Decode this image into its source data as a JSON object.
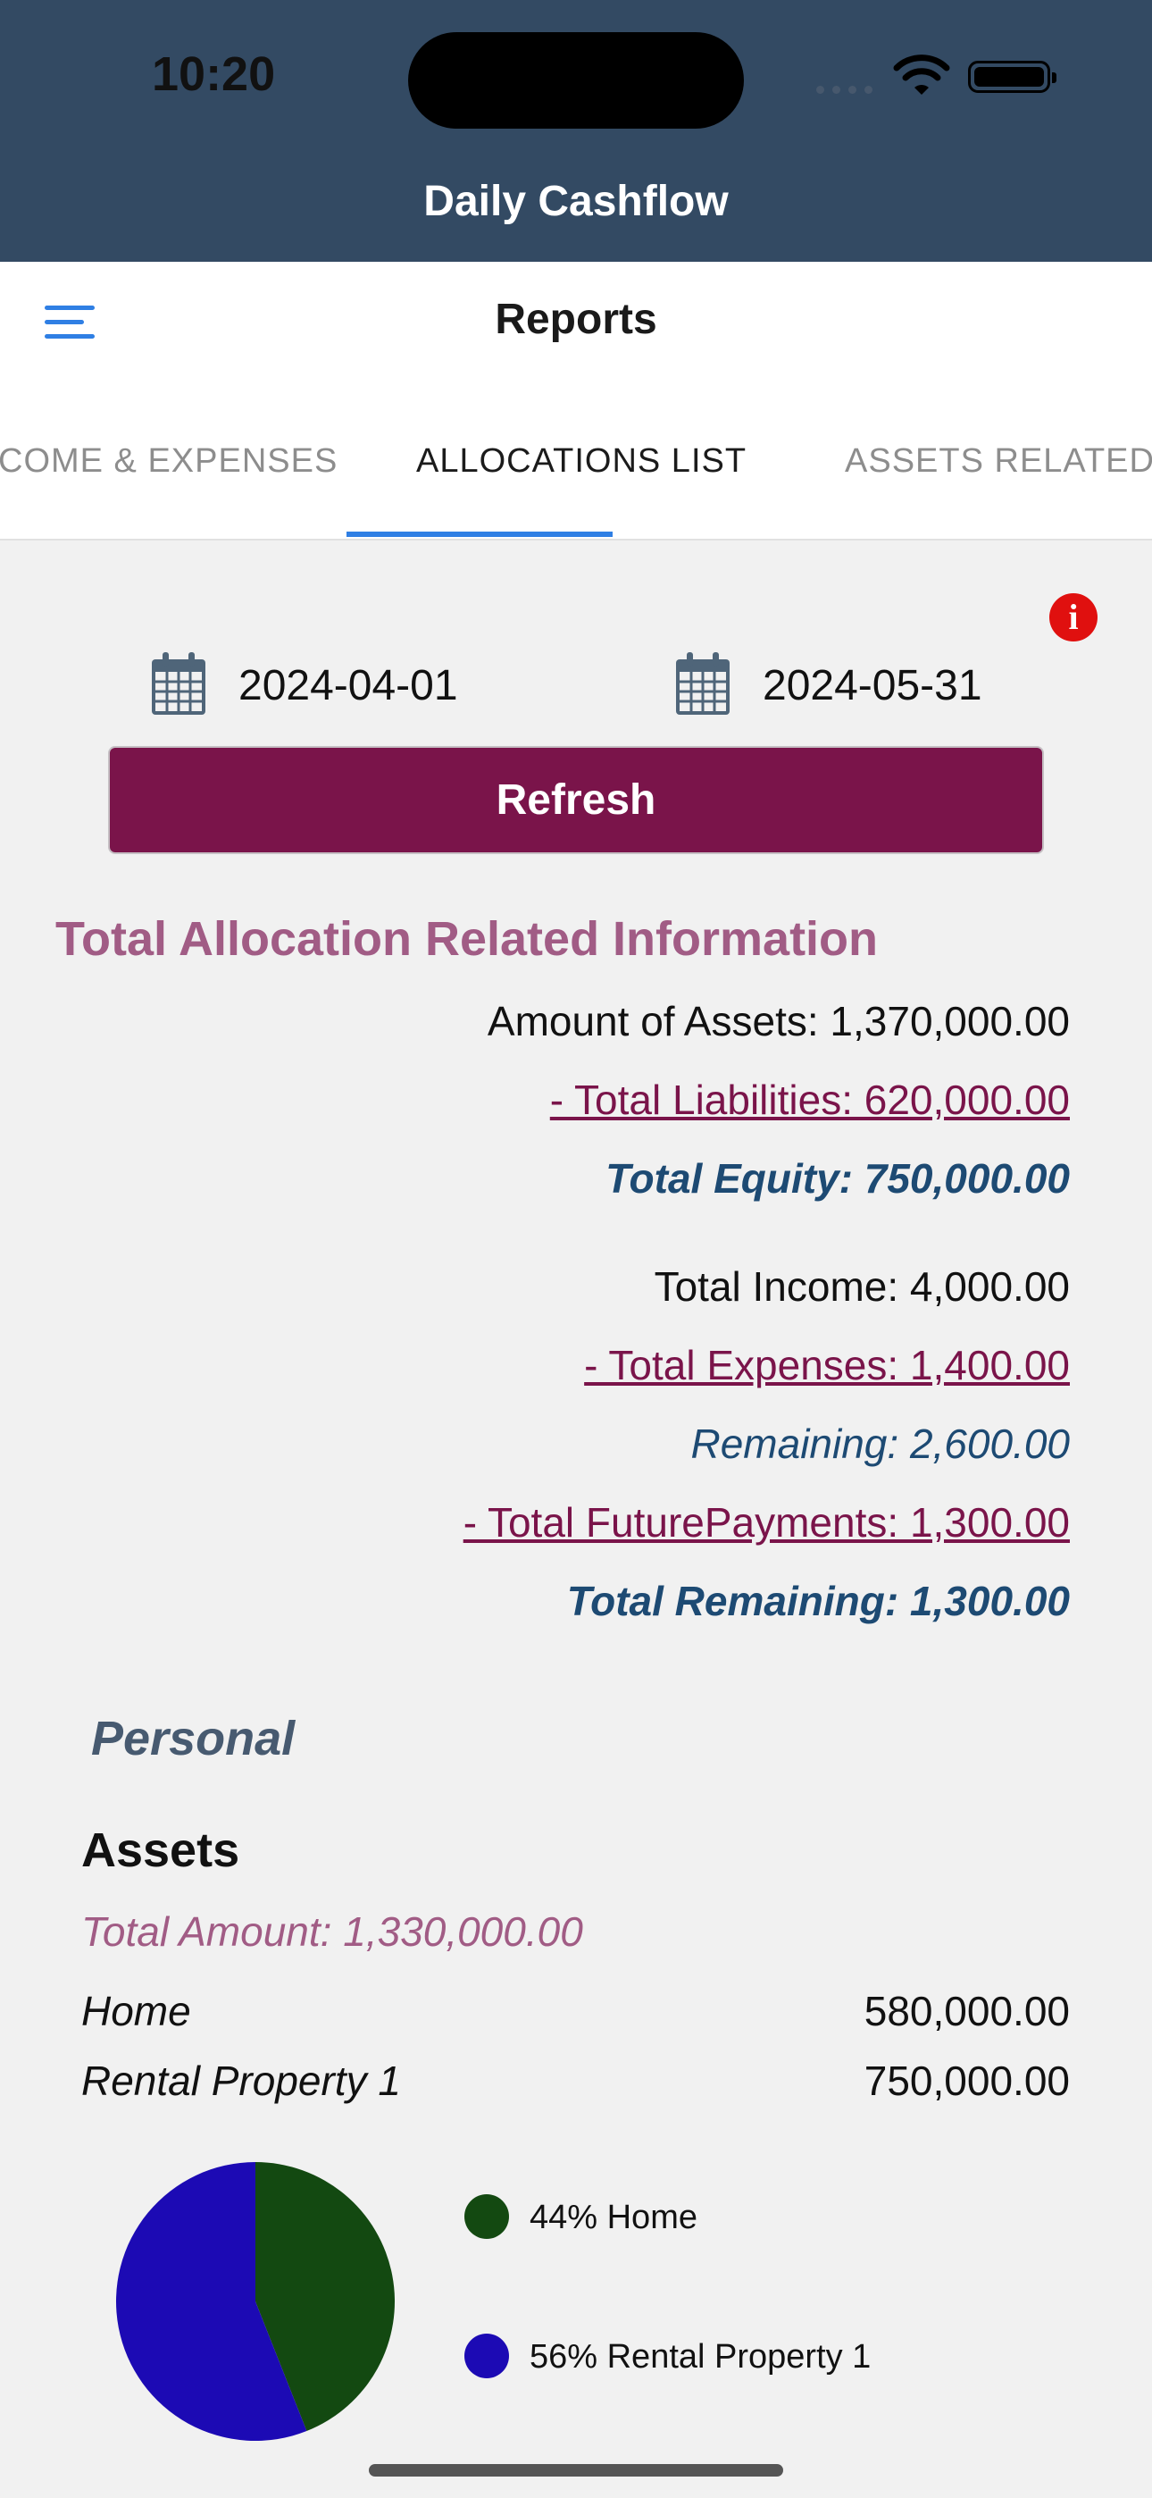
{
  "status_bar": {
    "time": "10:20"
  },
  "header": {
    "app_title": "Daily Cashflow",
    "page_title": "Reports"
  },
  "tabs": [
    {
      "label": "INCOME & EXPENSES",
      "active": false
    },
    {
      "label": "ALLOCATIONS LIST",
      "active": true
    },
    {
      "label": "ASSETS RELATED INFO",
      "active": false
    }
  ],
  "filters": {
    "start_date": "2024-04-01",
    "end_date": "2024-05-31",
    "refresh_label": "Refresh",
    "info_icon": "i"
  },
  "totals": {
    "title": "Total Allocation Related Information",
    "amount_of_assets": "Amount of Assets: 1,370,000.00",
    "total_liabilities": "- Total Liabilities: 620,000.00",
    "total_equity": "Total Equity: 750,000.00",
    "total_income": "Total Income: 4,000.00",
    "total_expenses": "- Total Expenses: 1,400.00",
    "remaining": "Remaining: 2,600.00",
    "total_future_payments": "- Total FuturePayments: 1,300.00",
    "total_remaining": "Total Remaining: 1,300.00"
  },
  "personal": {
    "group_title": "Personal",
    "assets": {
      "title": "Assets",
      "total_amount": "Total Amount: 1,330,000.00",
      "items": [
        {
          "name": "Home",
          "value": "580,000.00"
        },
        {
          "name": "Rental Property 1",
          "value": "750,000.00"
        }
      ]
    }
  },
  "chart_data": {
    "type": "pie",
    "slices": [
      {
        "label": "44% Home",
        "name": "Home",
        "percent": 44,
        "value": 580000,
        "color": "#134911"
      },
      {
        "label": "56% Rental Property 1",
        "name": "Rental Property 1",
        "percent": 56,
        "value": 750000,
        "color": "#1c0ab4"
      }
    ],
    "legend_placement": "right"
  },
  "colors": {
    "header_bg": "#334a63",
    "accent": "#2f7fe4",
    "button_bg": "#7a144a",
    "link": "#7a144a",
    "equity_blue": "#1d4a73",
    "section_pink": "#a15c85"
  }
}
